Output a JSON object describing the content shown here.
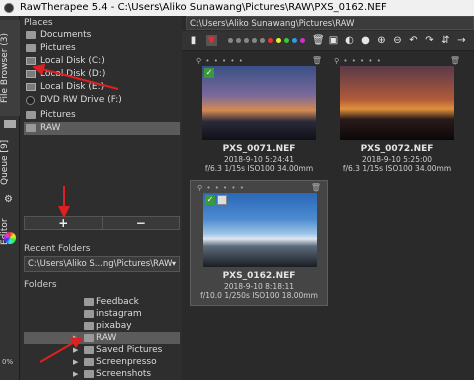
{
  "window": {
    "title": "RawTherapee 5.4 - C:\\Users\\Aliko Sunawang\\Pictures\\RAW\\PXS_0162.NEF"
  },
  "vtabs": {
    "browser": "File Browser (3)",
    "queue": "Queue [9]",
    "editor": "Editor",
    "progress": "0%"
  },
  "places": {
    "label": "Places",
    "items": [
      {
        "label": "Documents",
        "icon": "folder-icon"
      },
      {
        "label": "Pictures",
        "icon": "folder-icon"
      },
      {
        "label": "Local Disk (C:)",
        "icon": "disk-icon"
      },
      {
        "label": "Local Disk (D:)",
        "icon": "disk-icon"
      },
      {
        "label": "Local Disk (E:)",
        "icon": "disk-icon"
      },
      {
        "label": "DVD RW Drive (F:)",
        "icon": "dvd-icon"
      },
      {
        "label": "Pictures",
        "icon": "folder-icon"
      },
      {
        "label": "RAW",
        "icon": "folder-icon"
      }
    ],
    "add": "+",
    "remove": "−"
  },
  "recent": {
    "label": "Recent Folders",
    "value": "C:\\Users\\Aliko S...ng\\Pictures\\RAW"
  },
  "folders": {
    "label": "Folders",
    "items": [
      {
        "label": "Feedback"
      },
      {
        "label": "instagram"
      },
      {
        "label": "pixabay"
      },
      {
        "label": "RAW"
      },
      {
        "label": "Saved Pictures"
      },
      {
        "label": "Screenpresso"
      },
      {
        "label": "Screenshots"
      }
    ]
  },
  "browser": {
    "path": "C:\\Users\\Aliko Sunawang\\Pictures\\RAW",
    "thumbs": [
      {
        "name": "PXS_0071.NEF",
        "date": "2018-9-10 5:24:41",
        "exif": "f/6.3 1/15s ISO100 34.00mm"
      },
      {
        "name": "PXS_0072.NEF",
        "date": "2018-9-10 5:25:00",
        "exif": "f/6.3 1/15s ISO100 34.00mm"
      },
      {
        "name": "PXS_0162.NEF",
        "date": "2018-9-10 8:18:11",
        "exif": "f/10.0 1/250s ISO100 18.00mm"
      }
    ]
  },
  "colors": {
    "accent_red": "#e02020",
    "check_green": "#3a9a3a"
  }
}
